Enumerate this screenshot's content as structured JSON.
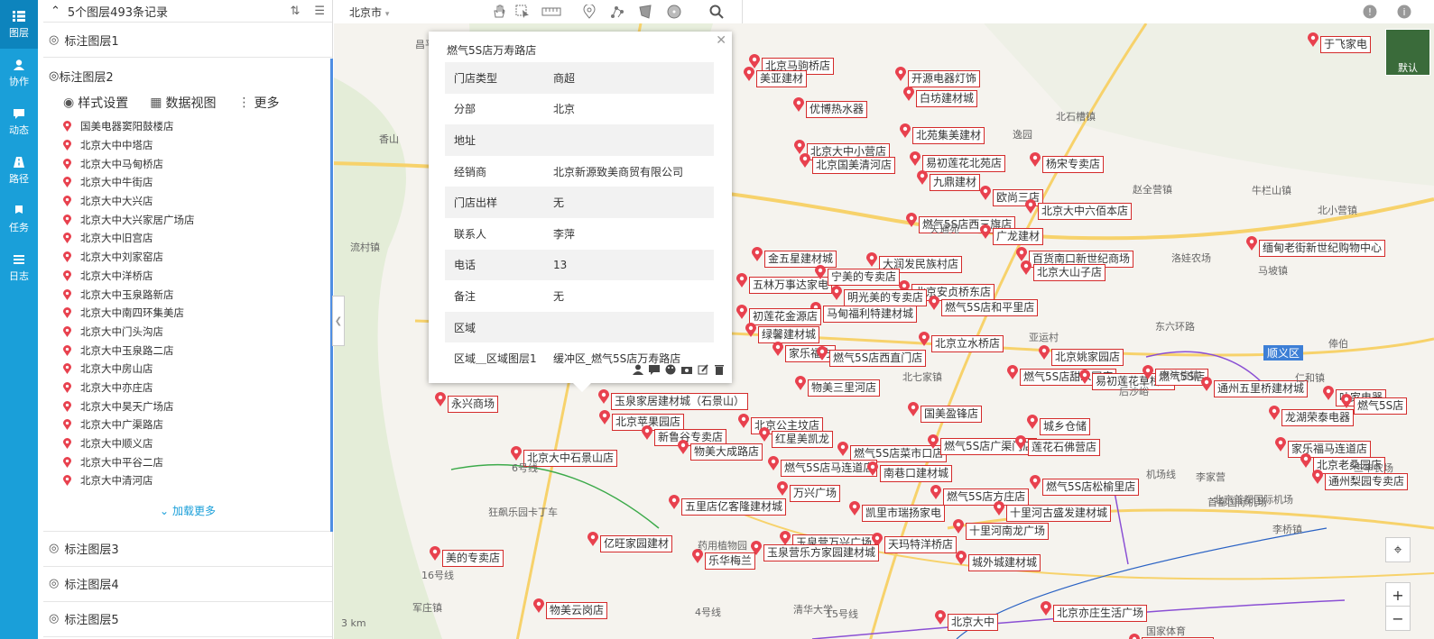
{
  "nav": [
    {
      "label": "图层",
      "icon": "layers-icon"
    },
    {
      "label": "协作",
      "icon": "user-icon"
    },
    {
      "label": "动态",
      "icon": "chat-icon"
    },
    {
      "label": "路径",
      "icon": "route-icon"
    },
    {
      "label": "任务",
      "icon": "flag-icon"
    },
    {
      "label": "日志",
      "icon": "list-icon"
    }
  ],
  "panel": {
    "summary": "5个图层493条记录",
    "layer1": "标注图层1",
    "layer2": "标注图层2",
    "tools": {
      "style": "样式设置",
      "data": "数据视图",
      "more": "更多"
    },
    "stores": [
      "国美电器窦阳鼓楼店",
      "北京大中中塔店",
      "北京大中马甸桥店",
      "北京大中牛街店",
      "北京大中大兴店",
      "北京大中大兴家居广场店",
      "北京大中旧宫店",
      "北京大中刘家窑店",
      "北京大中洋桥店",
      "北京大中玉泉路新店",
      "北京大中南四环集美店",
      "北京大中门头沟店",
      "北京大中玉泉路二店",
      "北京大中房山店",
      "北京大中亦庄店",
      "北京大中昊天广场店",
      "北京大中广渠路店",
      "北京大中顺义店",
      "北京大中平谷二店",
      "北京大中清河店"
    ],
    "load_more": "加载更多",
    "layer3": "标注图层3",
    "layer4": "标注图层4",
    "layer5": "标注图层5"
  },
  "topbar": {
    "city": "北京市"
  },
  "popup": {
    "title": "燃气5S店万寿路店",
    "rows": [
      {
        "k": "门店类型",
        "v": "商超"
      },
      {
        "k": "分部",
        "v": "北京"
      },
      {
        "k": "地址",
        "v": ""
      },
      {
        "k": "经销商",
        "v": "北京新源致美商贸有限公司"
      },
      {
        "k": "门店出样",
        "v": "无"
      },
      {
        "k": "联系人",
        "v": "李萍"
      },
      {
        "k": "电话",
        "v": "13"
      },
      {
        "k": "备注",
        "v": "无"
      },
      {
        "k": "区域",
        "v": ""
      },
      {
        "k": "区域＿区域图层1",
        "v": "缓冲区_燃气5S店万寿路店"
      }
    ]
  },
  "map": {
    "labels": [
      "于飞家电",
      "北京马驹桥店",
      "美亚建材",
      "开源电器灯饰",
      "白坊建材城",
      "优博热水器",
      "北苑集美建材",
      "北京大中小营店",
      "北京国美清河店",
      "易初莲花北苑店",
      "杨宋专卖店",
      "九鼎建材",
      "欧尚三店",
      "北京大中六佰本店",
      "燃气5S店西三旗店",
      "广龙建材",
      "缅甸老街新世纪购物中心",
      "金五星建材城",
      "大润发民族村店",
      "百货南口新世纪商场",
      "北京大山子店",
      "五林万事达家电",
      "宁美的专卖店",
      "北京安贞桥东店",
      "明光美的专卖店",
      "燃气5S店和平里店",
      "马甸福利特建材城",
      "初莲花金源店",
      "绿馨建材城",
      "北京立水桥店",
      "家乐福方",
      "燃气5S店西直门店",
      "北京姚家园店",
      "燃气5S店甜水园店",
      "易初莲花草桥店",
      "燃气5S店",
      "通州五里桥建材城",
      "叶家电器",
      "永兴商场",
      "玉泉家居建材城（石景山）",
      "物美三里河店",
      "国美盈锋店",
      "北京苹果园店",
      "北京公主坟店",
      "城乡仓储",
      "新鲁谷专卖店",
      "红星美凯龙",
      "燃气5S店菜市口店",
      "燃气5S店广渠门店",
      "莲花石佛营店",
      "龙湖荣泰电器",
      "物美大成路店",
      "燃气5S店马连道店",
      "北京大中石景山店",
      "南巷口建材城",
      "燃气5S店松榆里店",
      "五里店亿客隆建材城",
      "万兴广场",
      "燃气5S店方庄店",
      "十里河古盛发建材城",
      "凯里市瑞扬家电",
      "十里河南龙广场",
      "亿旺家园建材",
      "玉泉营万兴广场",
      "天玛特洋桥店",
      "玉泉营乐方家园建材城",
      "乐华梅兰",
      "家乐福马连道店",
      "北京老桑园店",
      "通州梨园专卖店",
      "美的专卖店",
      "城外城建材城",
      "北京亦庄生活广场",
      "物美云岗店",
      "燃气5S店",
      "家乐福宣武门",
      "北京大中"
    ],
    "places": [
      "流村镇",
      "百善镇",
      "北七家镇",
      "逸园",
      "北石槽镇",
      "赵全营镇",
      "洛娃农场",
      "牛栏山镇",
      "北小营镇",
      "马坡镇",
      "东六环路",
      "顺义区",
      "仁和镇",
      "南法信镇",
      "首都国际机场",
      "李桥镇",
      "俸伯",
      "军庄镇",
      "西山",
      "狂飙乐园卡丁车",
      "药用植物园",
      "清华大学",
      "国家体育",
      "香山",
      "昌平",
      "机场线",
      "6号线",
      "16号线",
      "4号线",
      "15号线",
      "亚运村",
      "北京首都国际机场",
      "后沙峪",
      "李家营",
      "三丰农场",
      "天通苑",
      "3 km"
    ]
  }
}
